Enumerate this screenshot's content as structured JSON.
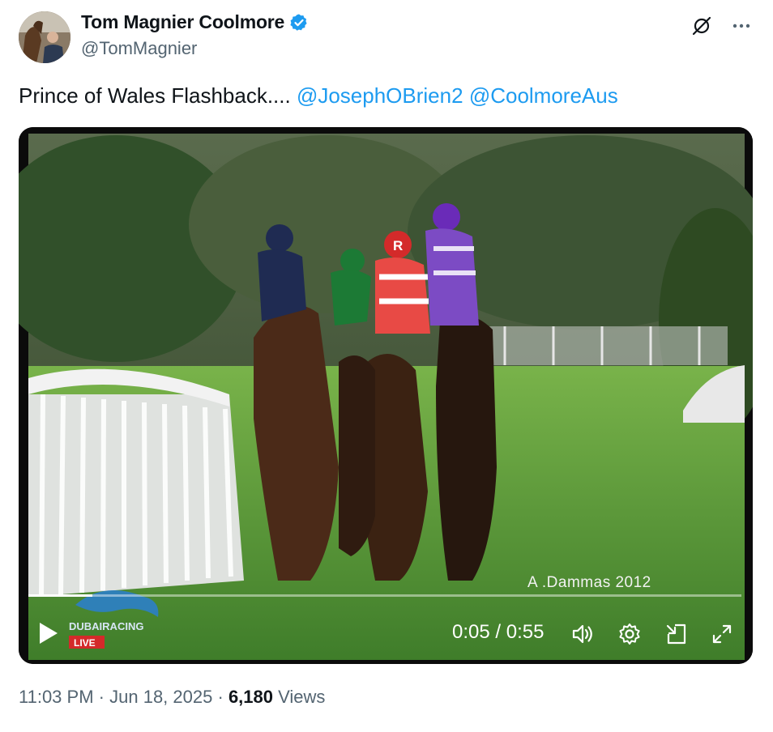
{
  "author": {
    "display_name": "Tom Magnier Coolmore",
    "handle": "@TomMagnier"
  },
  "tweet": {
    "text_prefix": "Prince of Wales Flashback.... ",
    "mentions": [
      "@JosephOBrien2",
      "@CoolmoreAus"
    ]
  },
  "video": {
    "watermark": "A .Dammas 2012",
    "channel_logo_text": "DUBAIRACING",
    "live_badge": "LIVE",
    "current_time": "0:05",
    "duration": "0:55",
    "progress": 0.09,
    "time_display": "0:05 / 0:55"
  },
  "meta": {
    "time": "11:03 PM",
    "separator": "·",
    "date": "Jun 18, 2025",
    "views_count": "6,180",
    "views_label": "Views"
  },
  "colors": {
    "accent": "#1d9bf0",
    "secondary_text": "#536471",
    "primary_text": "#0f1419"
  },
  "icons": {
    "verified": "verified-badge-icon",
    "grok": "grok-icon",
    "more": "more-icon",
    "play": "play-icon",
    "volume": "volume-icon",
    "settings": "settings-icon",
    "minimize": "minimize-icon",
    "fullscreen": "fullscreen-icon"
  }
}
